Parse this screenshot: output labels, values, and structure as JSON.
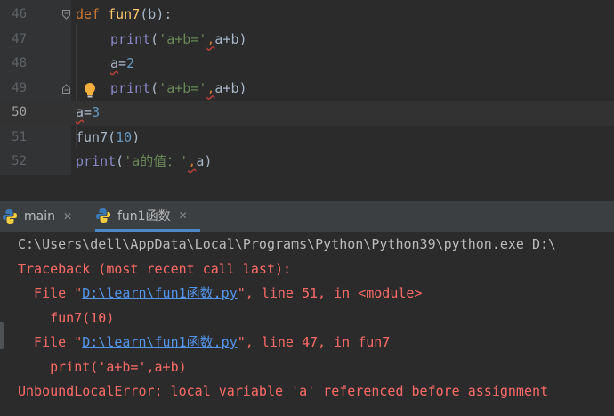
{
  "editor": {
    "lines": [
      {
        "num": "46"
      },
      {
        "num": "47"
      },
      {
        "num": "48"
      },
      {
        "num": "49"
      },
      {
        "num": "50"
      },
      {
        "num": "51"
      },
      {
        "num": "52"
      }
    ],
    "tokens": {
      "def": "def",
      "fun7": "fun7",
      "b_param": "(b):",
      "print": "print",
      "paren_open": "(",
      "str_ab": "'a+b='",
      "comma": ",",
      "a_plus_b": "a+b",
      "paren_close": ")",
      "a_var": "a",
      "eq": "=",
      "two": "2",
      "three": "3",
      "fun7_call": "fun7",
      "ten": "10",
      "str_val": "'a的值：'",
      "a_arg": "a"
    }
  },
  "run_tabs": [
    {
      "label": "main",
      "active": false
    },
    {
      "label": "fun1函数",
      "active": true
    }
  ],
  "console": {
    "cmd": "C:\\Users\\dell\\AppData\\Local\\Programs\\Python\\Python39\\python.exe D:\\",
    "traceback": "Traceback (most recent call last):",
    "file_prefix": "  File \"",
    "file_path": "D:\\learn\\fun1函数.py",
    "file1_suffix": "\", line 51, in <module>",
    "code1": "    fun7(10)",
    "file2_suffix": "\", line 47, in fun7",
    "code2": "    print('a+b=',a+b)",
    "error": "UnboundLocalError: local variable 'a' referenced before assignment"
  },
  "colors": {
    "background": "#2b2b2b",
    "error": "#ff6b68",
    "link": "#5394ec",
    "keyword": "#cc7832"
  }
}
